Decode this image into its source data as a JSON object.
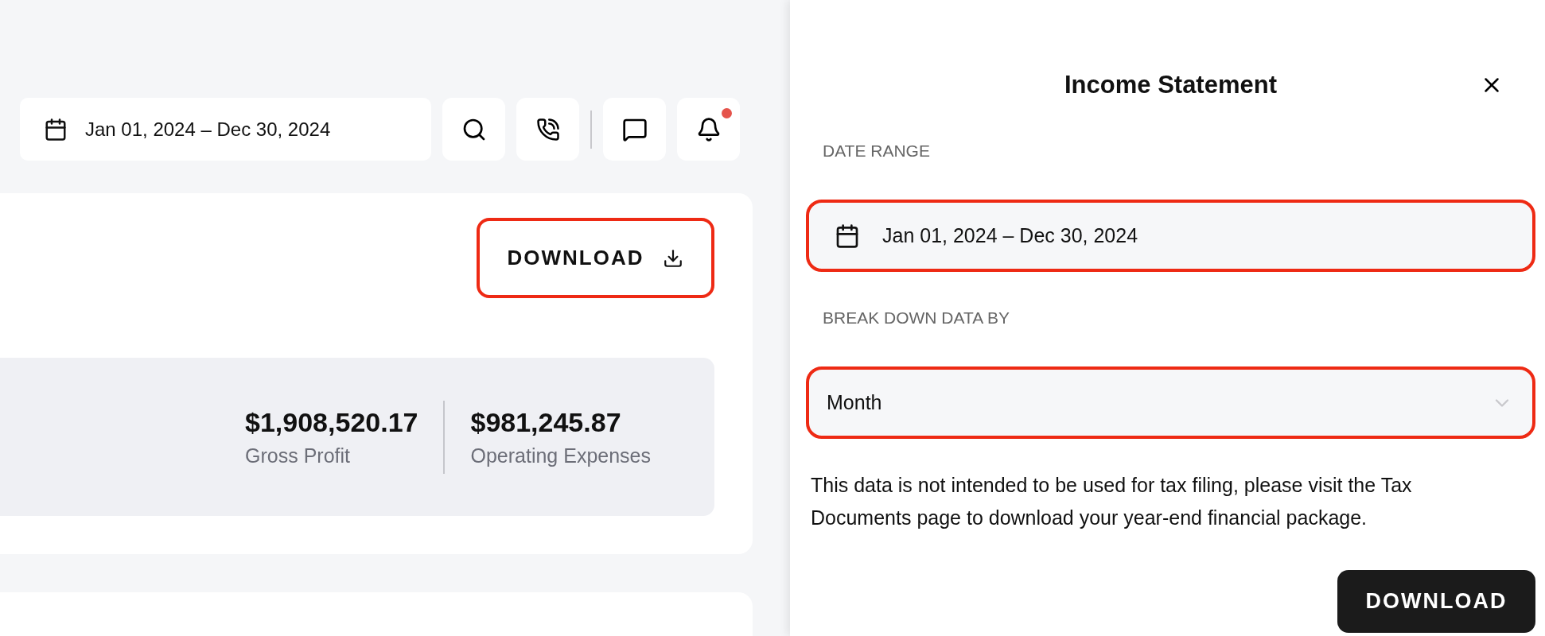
{
  "header": {
    "date_range": "Jan 01, 2024 – Dec 30, 2024",
    "bell_unread": true
  },
  "report_card": {
    "download_button": {
      "label": "DOWNLOAD",
      "highlighted": true
    },
    "summary": [
      {
        "value": "$1,908,520.17",
        "label": "Gross Profit"
      },
      {
        "value": "$981,245.87",
        "label": "Operating Expenses"
      }
    ]
  },
  "panel": {
    "title": "Income Statement",
    "date_range_label": "DATE RANGE",
    "date_range": {
      "value": "Jan 01, 2024 – Dec 30, 2024",
      "highlighted": true
    },
    "breakdown_label": "BREAK DOWN DATA BY",
    "breakdown": {
      "value": "Month",
      "highlighted": true
    },
    "note": "This data is not intended to be used for tax filing, please visit the Tax Documents page to download your year-end financial package.",
    "download_button": {
      "label": "DOWNLOAD"
    }
  }
}
